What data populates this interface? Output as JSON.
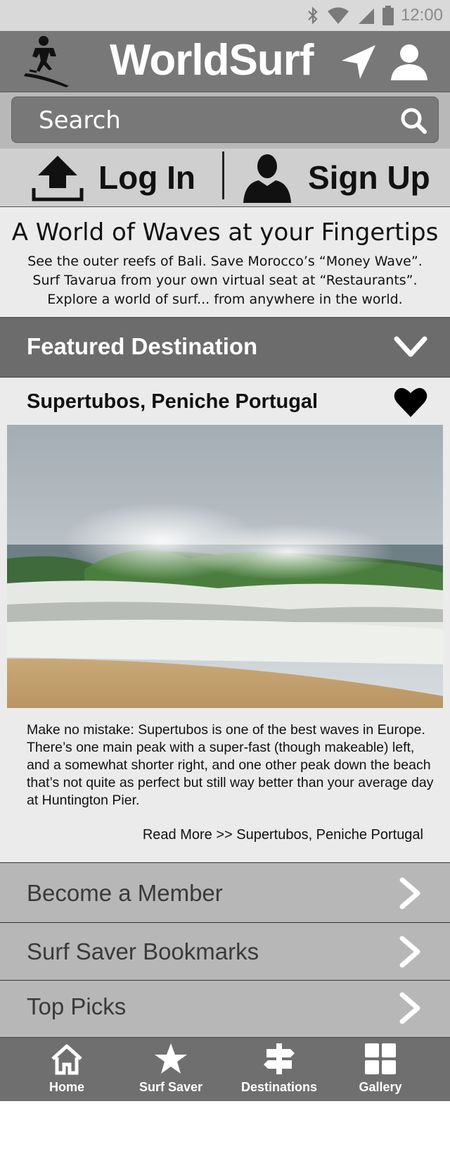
{
  "status_bar": {
    "time": "12:00"
  },
  "app_bar": {
    "title": "WorldSurf"
  },
  "search": {
    "placeholder": "Search"
  },
  "auth": {
    "login_label": "Log In",
    "signup_label": "Sign Up"
  },
  "intro": {
    "heading": "A World of Waves at your Fingertips",
    "text": "See the outer reefs of Bali. Save Morocco’s “Money Wave”.\nSurf Tavarua from your own virtual seat at “Restaurants”.\nExplore a world of surf... from anywhere in the world."
  },
  "featured": {
    "header": "Featured Destination",
    "destination_name": "Supertubos, Peniche Portugal",
    "description": "Make no mistake: Supertubos is one of the best waves in Europe. There’s one main peak with a super-fast (though makeable) left, and a somewhat shorter right, and one other peak down the beach that’s not quite as perfect but still way better than your average day at Huntington Pier.",
    "read_more": "Read More >> Supertubos, Peniche Portugal"
  },
  "menu": [
    {
      "label": "Become a Member"
    },
    {
      "label": "Surf Saver Bookmarks"
    },
    {
      "label": "Top Picks"
    }
  ],
  "bottom_nav": [
    {
      "label": "Home",
      "icon": "home-icon"
    },
    {
      "label": "Surf Saver",
      "icon": "star-icon"
    },
    {
      "label": "Destinations",
      "icon": "signpost-icon"
    },
    {
      "label": "Gallery",
      "icon": "grid-icon"
    }
  ],
  "colors": {
    "app_bar": "#787878",
    "featured_header": "#6c6c6c",
    "menu_item": "#b7b7b7",
    "bottom_nav": "#6f6f6f"
  }
}
